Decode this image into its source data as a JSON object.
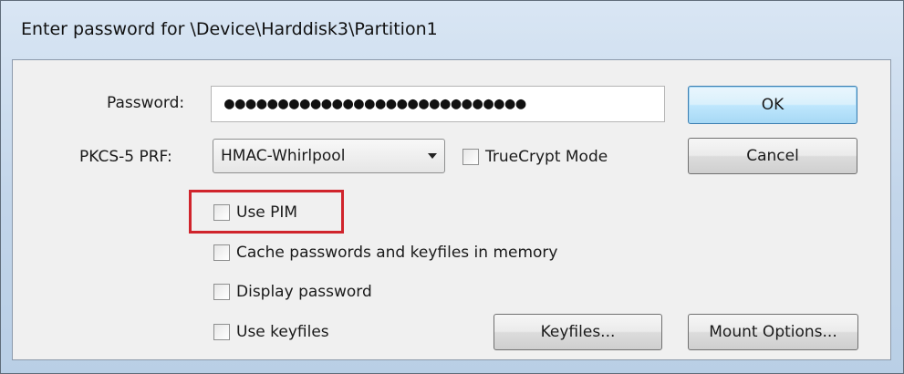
{
  "window": {
    "title": "Enter password for \\Device\\Harddisk3\\Partition1"
  },
  "form": {
    "password_label": "Password:",
    "password_value": "●●●●●●●●●●●●●●●●●●●●●●●●●●●●",
    "prf_label": "PKCS-5 PRF:",
    "prf_selected": "HMAC-Whirlpool",
    "truecrypt_mode_label": "TrueCrypt Mode",
    "truecrypt_mode_checked": false
  },
  "options": [
    {
      "label": "Use PIM",
      "checked": false
    },
    {
      "label": "Cache passwords and keyfiles in memory",
      "checked": false
    },
    {
      "label": "Display password",
      "checked": false
    },
    {
      "label": "Use keyfiles",
      "checked": false
    }
  ],
  "buttons": {
    "ok": "OK",
    "cancel": "Cancel",
    "keyfiles": "Keyfiles...",
    "mount_options": "Mount Options..."
  },
  "colors": {
    "highlight": "#d0242c",
    "default_button_border": "#3c7fb1"
  }
}
